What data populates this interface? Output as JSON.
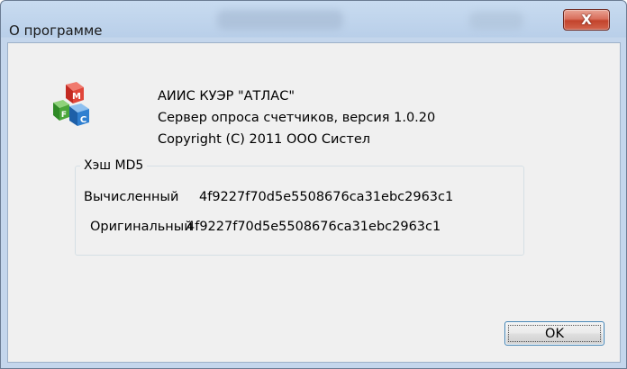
{
  "window": {
    "title": "О программе",
    "close_glyph": "X"
  },
  "about": {
    "product_name": "АИИС КУЭР \"АТЛАС\"",
    "description": "Сервер опроса счетчиков, версия  1.0.20",
    "copyright": "Copyright (C) 2011 ООО Систел",
    "icon": "mfc-cubes-icon"
  },
  "hash_group": {
    "legend": "Хэш MD5",
    "computed_label": "Вычисленный",
    "computed_value": "4f9227f70d5e5508676ca31ebc2963c1",
    "original_label": "Оригинальный",
    "original_value": "4f9227f70d5e5508676ca31ebc2963c1"
  },
  "buttons": {
    "ok_label": "OK"
  },
  "colors": {
    "close_button": "#c74b34",
    "ok_border": "#3c7fb1",
    "icon_red": "#d9362b",
    "icon_green": "#4aa63a",
    "icon_blue": "#2f7fd0"
  }
}
